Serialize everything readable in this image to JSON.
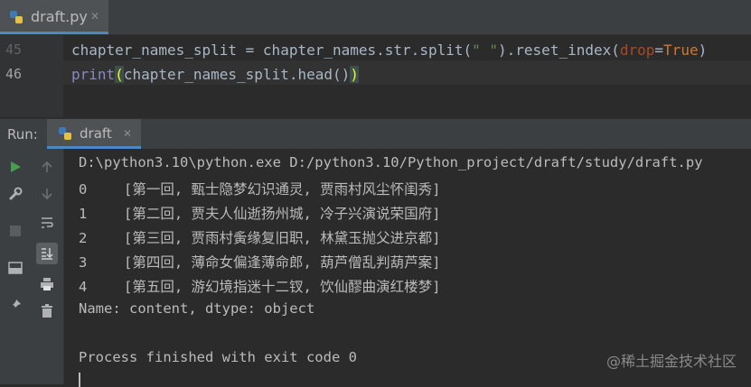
{
  "editor": {
    "file_tab": "draft.py",
    "line_numbers": [
      "45",
      "46"
    ],
    "line45": {
      "part1": "chapter_names_split = chapter_names.str.split(",
      "string": "\" \"",
      "part2": ").reset_index(",
      "param": "drop",
      "eq": "=",
      "value": "True",
      "close": ")"
    },
    "line46": {
      "func": "print",
      "open": "(",
      "middle": "chapter_names_split.head()",
      "close": ")"
    }
  },
  "run": {
    "label": "Run:",
    "tab": "draft"
  },
  "console": {
    "command": "D:\\python3.10\\python.exe D:/python3.10/Python_project/draft/study/draft.py",
    "rows": [
      {
        "index": "0",
        "text": "[第一回, 甄士隐梦幻识通灵, 贾雨村风尘怀闺秀]"
      },
      {
        "index": "1",
        "text": "[第二回, 贾夫人仙逝扬州城, 冷子兴演说荣国府]"
      },
      {
        "index": "2",
        "text": "[第三回, 贾雨村夤缘复旧职, 林黛玉抛父进京都]"
      },
      {
        "index": "3",
        "text": "[第四回, 薄命女偏逢薄命郎, 葫芦僧乱判葫芦案]"
      },
      {
        "index": "4",
        "text": "[第五回, 游幻境指迷十二钗, 饮仙醪曲演红楼梦]"
      }
    ],
    "dtype_line": "Name: content, dtype: object",
    "finish_line": "Process finished with exit code 0"
  },
  "watermark": "@稀土掘金技术社区",
  "icons": [
    "python-file-icon",
    "close-icon",
    "rerun-icon",
    "wrench-icon",
    "stop-icon",
    "layout-icon",
    "pin-icon",
    "up-arrow-icon",
    "down-arrow-icon",
    "soft-wrap-icon",
    "scroll-to-end-icon",
    "print-icon",
    "trash-icon"
  ]
}
